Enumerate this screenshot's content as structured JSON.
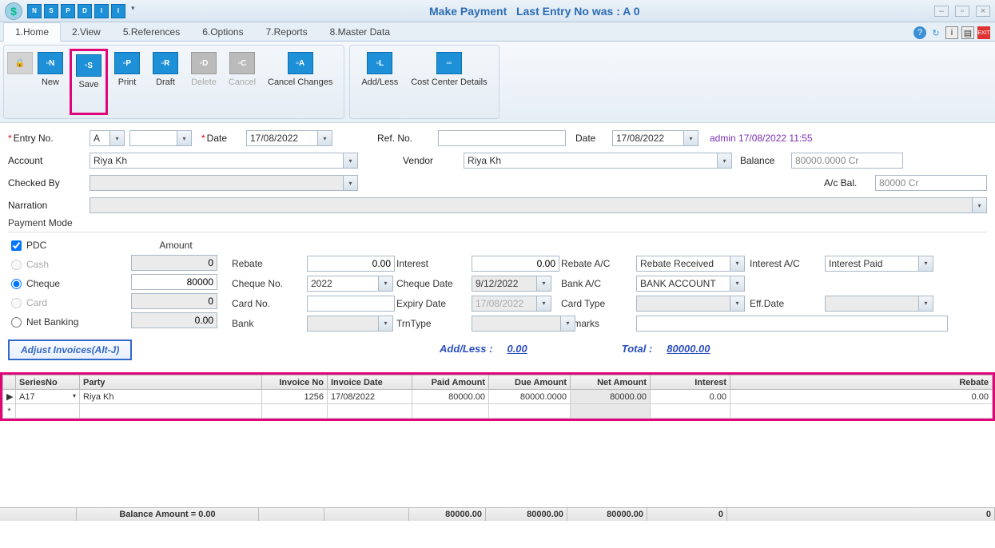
{
  "title_main": "Make Payment",
  "title_sub": "Last Entry No was : A 0",
  "quick_access": [
    "N",
    "S",
    "P",
    "D",
    "I",
    "I"
  ],
  "tabs": [
    "1.Home",
    "2.View",
    "5.References",
    "6.Options",
    "7.Reports",
    "8.Master Data"
  ],
  "ribbon": {
    "g1": [
      {
        "label": "New",
        "icon": "N",
        "style": "blue"
      },
      {
        "label": "Save",
        "icon": "S",
        "style": "blue",
        "highlight": true
      },
      {
        "label": "Print",
        "icon": "P",
        "style": "blue"
      },
      {
        "label": "Draft",
        "icon": "R",
        "style": "blue"
      },
      {
        "label": "Delete",
        "icon": "D",
        "style": "gray",
        "disabled": true
      },
      {
        "label": "Cancel",
        "icon": "C",
        "style": "gray",
        "disabled": true
      },
      {
        "label": "Cancel Changes",
        "icon": "A",
        "style": "blue"
      }
    ],
    "g2": [
      {
        "label": "Add/Less",
        "icon": "L",
        "style": "blue"
      },
      {
        "label": "Cost Center Details",
        "icon": "CC",
        "style": "blue"
      }
    ]
  },
  "form": {
    "entry_no_label": "Entry No.",
    "entry_series": "A",
    "entry_num": "",
    "date_label": "Date",
    "date": "17/08/2022",
    "ref_label": "Ref. No.",
    "ref": "",
    "date2_label": "Date",
    "date2": "17/08/2022",
    "stamp": "admin 17/08/2022 11:55",
    "account_label": "Account",
    "account": "Riya Kh",
    "vendor_label": "Vendor",
    "vendor": "Riya Kh",
    "balance_label": "Balance",
    "balance": "80000.0000 Cr",
    "acbal_label": "A/c Bal.",
    "acbal": "80000 Cr",
    "checked_label": "Checked By",
    "checked": "",
    "narration_label": "Narration",
    "narration": ""
  },
  "payment": {
    "section_label": "Payment Mode",
    "amount_header": "Amount",
    "pdc_label": "PDC",
    "pdc_checked": true,
    "cash_label": "Cash",
    "cash_amt": "0",
    "cheque_label": "Cheque",
    "cheque_amt": "80000",
    "card_label": "Card",
    "card_amt": "0",
    "net_label": "Net Banking",
    "net_amt": "0.00",
    "rebate_label": "Rebate",
    "rebate": "0.00",
    "interest_label": "Interest",
    "interest": "0.00",
    "rebateac_label": "Rebate A/C",
    "rebateac": "Rebate Received",
    "interestac_label": "Interest A/C",
    "interestac": "Interest Paid",
    "chequeno_label": "Cheque No.",
    "chequeno": "2022",
    "chequedate_label": "Cheque Date",
    "chequedate": "9/12/2022",
    "bankac_label": "Bank A/C",
    "bankac": "BANK ACCOUNT",
    "cardno_label": "Card No.",
    "cardno": "",
    "expiry_label": "Expiry Date",
    "expiry": "17/08/2022",
    "cardtype_label": "Card Type",
    "cardtype": "",
    "effdate_label": "Eff.Date",
    "effdate": "",
    "bank_label": "Bank",
    "bank": "",
    "trntype_label": "TrnType",
    "trntype": "",
    "remarks_label": "Remarks",
    "remarks": ""
  },
  "adjust_label": "Adjust Invoices(Alt-J)",
  "totals": {
    "addless_label": "Add/Less :",
    "addless": "0.00",
    "total_label": "Total :",
    "total": "80000.00"
  },
  "grid": {
    "headers": [
      "SeriesNo",
      "Party",
      "Invoice No",
      "Invoice Date",
      "Paid Amount",
      "Due Amount",
      "Net Amount",
      "Interest",
      "Rebate"
    ],
    "row": {
      "series": "A17",
      "party": "Riya Kh",
      "invoice": "1256",
      "invdate": "17/08/2022",
      "paid": "80000.00",
      "due": "80000.0000",
      "net": "80000.00",
      "interest": "0.00",
      "rebate": "0.00"
    }
  },
  "footer": {
    "balance_label": "Balance Amount = 0.00",
    "paid": "80000.00",
    "due": "80000.00",
    "net": "80000.00",
    "interest": "0",
    "rebate": "0"
  }
}
